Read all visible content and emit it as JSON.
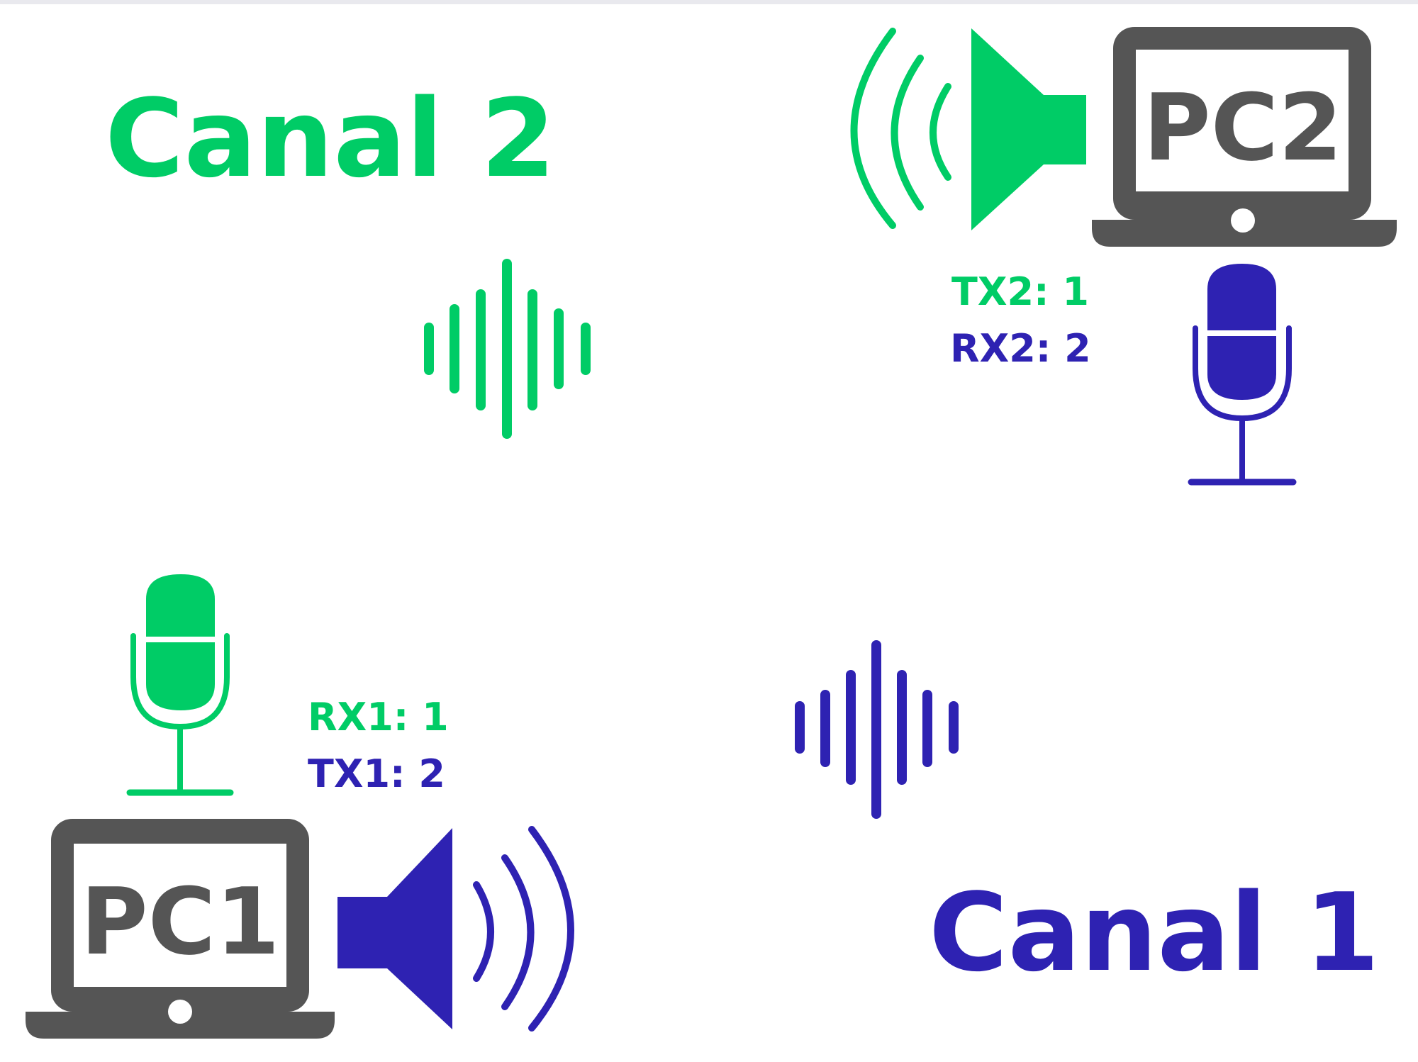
{
  "colors": {
    "green": "#00cc66",
    "blue": "#2e22b2",
    "gray": "#555555",
    "background": "#ffffff"
  },
  "channels": {
    "canal2": "Canal 2",
    "canal1": "Canal 1"
  },
  "pc1": {
    "label": "PC1",
    "rx": "RX1: 1",
    "tx": "TX1: 2",
    "icons": [
      "laptop-icon",
      "microphone-icon",
      "speaker-icon"
    ]
  },
  "pc2": {
    "label": "PC2",
    "tx": "TX2: 1",
    "rx": "RX2: 2",
    "icons": [
      "laptop-icon",
      "microphone-icon",
      "speaker-icon"
    ]
  },
  "waveforms": [
    "sound-wave-icon",
    "sound-wave-icon"
  ]
}
